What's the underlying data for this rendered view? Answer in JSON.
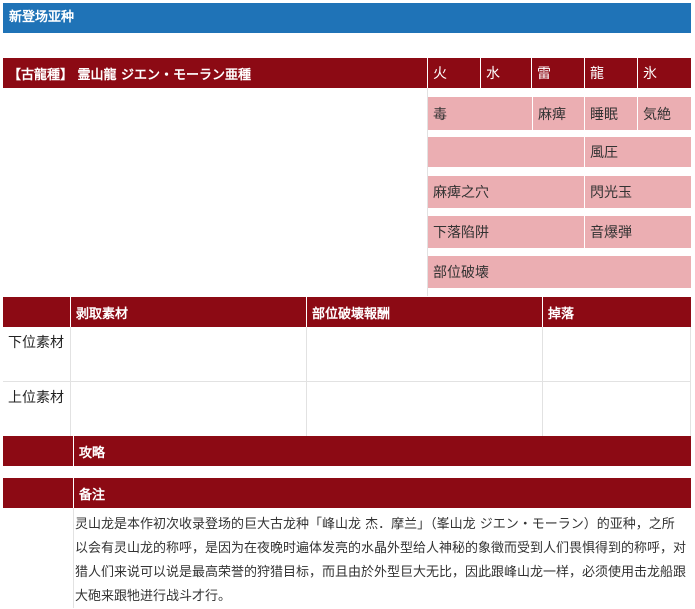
{
  "header": {
    "title": "新登场亚种"
  },
  "monster": {
    "name": "【古龍種】 霊山龍 ジエン・モーラン亜種",
    "elements": [
      "火",
      "水",
      "雷",
      "龍",
      "氷"
    ],
    "statuses": [
      "毒",
      "麻痺",
      "睡眠",
      "気絶"
    ],
    "items_right": [
      "風圧",
      "閃光玉",
      "音爆弾"
    ],
    "items_left": [
      "麻痺之穴",
      "下落陷阱",
      "部位破壊"
    ]
  },
  "materials": {
    "columns": [
      "剥取素材",
      "部位破壊報酬",
      "掉落"
    ],
    "rows": [
      "下位素材",
      "上位素材"
    ]
  },
  "strategy": {
    "title": "攻略"
  },
  "notes": {
    "title": "备注",
    "text": "灵山龙是本作初次收录登场的巨大古龙种「峰山龙 杰．摩兰」（峯山龙 ジエン・モーラン）的亚种，之所以会有灵山龙的称呼，是因为在夜晚时遍体发亮的水晶外型给人神秘的象徵而受到人们畏惧得到的称呼，对猎人们来说可以说是最高荣誉的狩猎目标，而且由於外型巨大无比，因此跟峰山龙一样，必须使用击龙船跟大砲来跟牠进行战斗才行。"
  }
}
